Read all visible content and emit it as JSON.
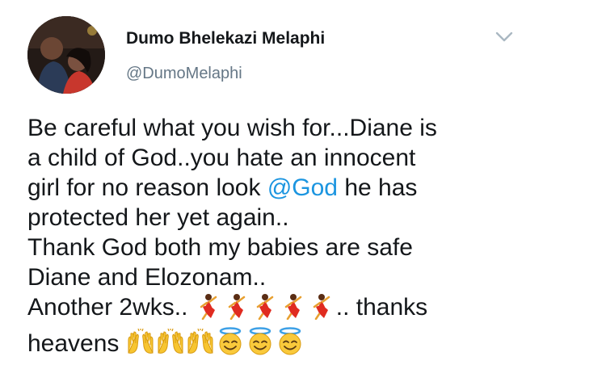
{
  "author": {
    "name": "Dumo Bhelekazi Melaphi",
    "handle": "@DumoMelaphi"
  },
  "icons": {
    "avatar": "profile-photo",
    "menu": "chevron-down-icon",
    "dancer": "dancer-emoji",
    "raised_hands": "raised-hands-emoji",
    "halo": "smiling-face-with-halo-emoji"
  },
  "colors": {
    "name": "#14171a",
    "handle": "#657786",
    "mention": "#1b95e0",
    "caret": "#aab8c2"
  },
  "tweet": {
    "line1": "Be careful what you wish for...Diane is",
    "line2": "a child of God..you hate an innocent",
    "line3_before": "girl for no reason look ",
    "line3_mention": "@God",
    "line3_after": " he has",
    "line4": "protected her yet again..",
    "line5": "Thank God both my babies are safe",
    "line6": "Diane and Elozonam..",
    "line7_before": "Another 2wks.. ",
    "line7_after": ".. thanks",
    "line8_before": "heavens "
  }
}
